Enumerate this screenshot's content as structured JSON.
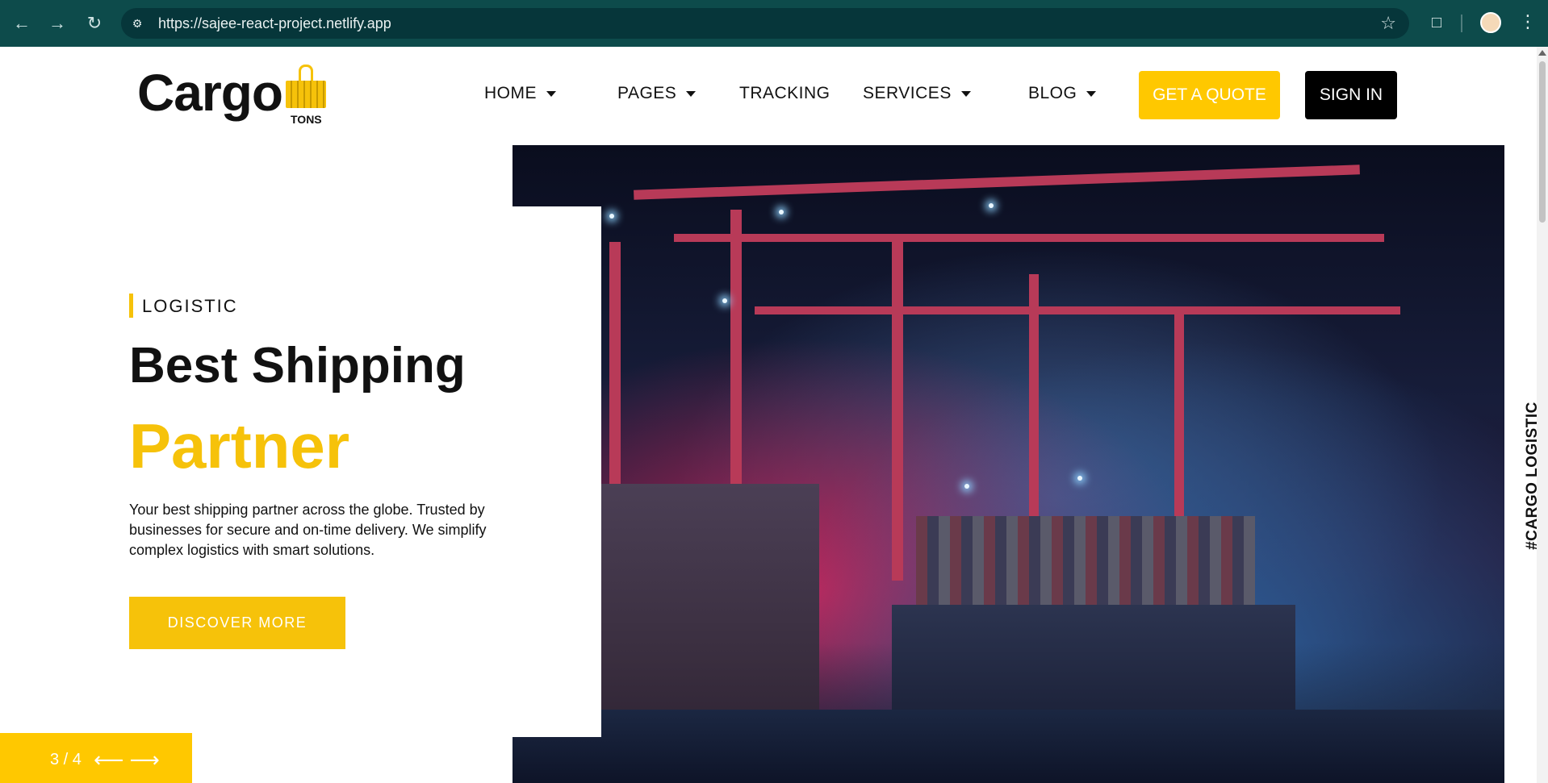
{
  "browser": {
    "url": "https://sajee-react-project.netlify.app"
  },
  "site": {
    "logo_text": "Cargo",
    "logo_sub": "TONS",
    "nav": [
      {
        "label": "HOME"
      },
      {
        "label": "PAGES"
      },
      {
        "label": "TRACKING"
      },
      {
        "label": "SERVICES"
      },
      {
        "label": "BLOG"
      }
    ],
    "quote_label": "GET A QUOTE",
    "signin_label": "SIGN IN"
  },
  "hero": {
    "tag": "LOGISTIC",
    "title_line1": "Best Shipping",
    "title_line2": "Partner",
    "description": "Your best shipping partner across the globe. Trusted by businesses for secure and on-time delivery. We simplify complex logistics with smart solutions.",
    "cta_label": "DISCOVER MORE",
    "slide_counter": "3 / 4",
    "side_text": "#CARGO LOGISTIC"
  },
  "colors": {
    "accent": "#f6c20a",
    "chrome": "#0d4b4b"
  }
}
